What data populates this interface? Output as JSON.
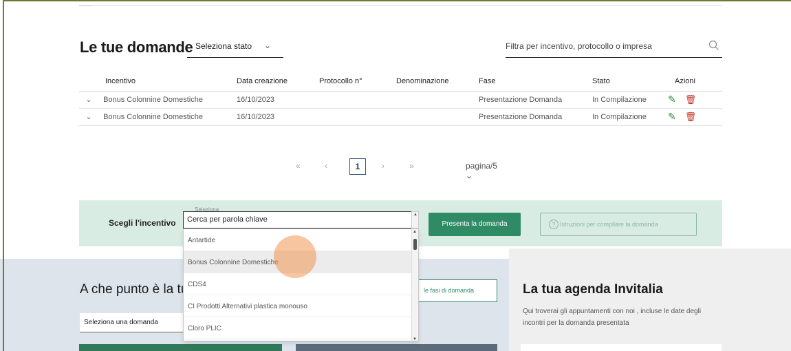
{
  "header": {
    "title": "Le tue domande",
    "status_select": "Seleziona stato",
    "filter_placeholder": "Filtra per incentivo, protocollo o impresa"
  },
  "table": {
    "columns": [
      "Incentivo",
      "Data creazione",
      "Protocollo n°",
      "Denominazione",
      "Fase",
      "Stato",
      "Azioni"
    ],
    "rows": [
      {
        "incentivo": "Bonus Colonnine Domestiche",
        "data": "16/10/2023",
        "protocollo": "",
        "denominazione": "",
        "fase": "Presentazione Domanda",
        "stato": "In Compilazione"
      },
      {
        "incentivo": "Bonus Colonnine Domestiche",
        "data": "16/10/2023",
        "protocollo": "",
        "denominazione": "",
        "fase": "Presentazione Domanda",
        "stato": "In Compilazione"
      }
    ]
  },
  "pager": {
    "first": "«",
    "prev": "‹",
    "current": "1",
    "next": "›",
    "last": "»",
    "per_page": "pagina/5 ⌄"
  },
  "incentive_picker": {
    "label": "Scegli l'incentivo",
    "small_label": "Cerca per parola chiave",
    "input_value": "Cerca per parola chiave",
    "options": [
      "Antartide",
      "Bonus Colonnine Domestiche",
      "CDS4",
      "CI Prodotti Alternativi plastica monouso",
      "Cloro PLIC"
    ],
    "highlighted_option": "Bonus Colonnine Domestiche",
    "presenta_button": "Presenta la domanda",
    "istruzioni_button": "Istruzioni per compilare la domanda"
  },
  "progress_section": {
    "title": "A che punto è la tu",
    "select_placeholder": "Seleziona una domanda",
    "fasi_button": "le fasi di domanda"
  },
  "agenda": {
    "title": "La tua agenda Invitalia",
    "text": "Qui troverai gli appuntamenti con noi , incluse le date degli incontri per la domanda presentata"
  },
  "colors": {
    "primary_green": "#2f8a66",
    "band_green": "#d9ece3",
    "blue_section": "#dde4eb",
    "edit_icon": "#2f8a3c",
    "delete_icon": "#c0392b"
  },
  "icons": {
    "search": "search-icon",
    "expand": "chevron-down-icon",
    "edit": "pencil-icon",
    "delete": "trash-icon",
    "info": "info-icon"
  }
}
